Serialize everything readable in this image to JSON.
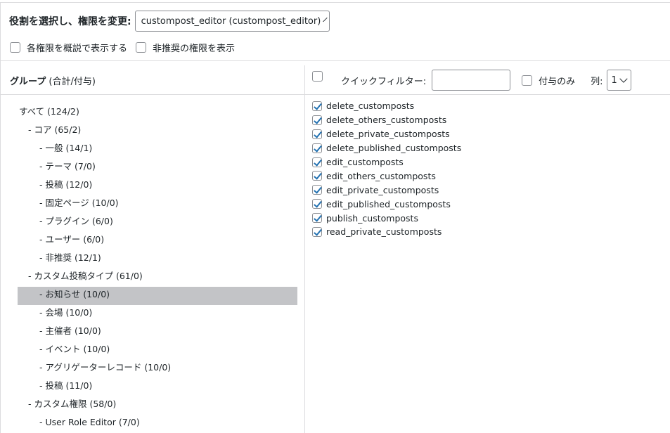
{
  "role": {
    "label": "役割を選択し、権限を変更:",
    "selected": "custompost_editor (custompost_editor)"
  },
  "options": {
    "show_readable": "各権限を概説で表示する",
    "show_deprecated": "非推奨の権限を表示"
  },
  "group_header": {
    "title": "グループ",
    "subtitle": "(合計/付与)"
  },
  "filter": {
    "quick_filter_label": "クイックフィルター:",
    "quick_filter_value": "",
    "granted_only_label": "付与のみ",
    "columns_label": "列:",
    "columns_value": "1"
  },
  "groups": [
    {
      "label": "すべて (124/2)",
      "level": 0,
      "selected": false
    },
    {
      "label": "- コア (65/2)",
      "level": 1,
      "selected": false
    },
    {
      "label": "- 一般 (14/1)",
      "level": 2,
      "selected": false
    },
    {
      "label": "- テーマ (7/0)",
      "level": 2,
      "selected": false
    },
    {
      "label": "- 投稿 (12/0)",
      "level": 2,
      "selected": false
    },
    {
      "label": "- 固定ページ (10/0)",
      "level": 2,
      "selected": false
    },
    {
      "label": "- プラグイン (6/0)",
      "level": 2,
      "selected": false
    },
    {
      "label": "- ユーザー (6/0)",
      "level": 2,
      "selected": false
    },
    {
      "label": "- 非推奨 (12/1)",
      "level": 2,
      "selected": false
    },
    {
      "label": "- カスタム投稿タイプ (61/0)",
      "level": 1,
      "selected": false
    },
    {
      "label": "- お知らせ (10/0)",
      "level": 2,
      "selected": true
    },
    {
      "label": "- 会場 (10/0)",
      "level": 2,
      "selected": false
    },
    {
      "label": "- 主催者 (10/0)",
      "level": 2,
      "selected": false
    },
    {
      "label": "- イベント (10/0)",
      "level": 2,
      "selected": false
    },
    {
      "label": "- アグリゲーターレコード (10/0)",
      "level": 2,
      "selected": false
    },
    {
      "label": "- 投稿 (11/0)",
      "level": 2,
      "selected": false
    },
    {
      "label": "- カスタム権限 (58/0)",
      "level": 1,
      "selected": false
    },
    {
      "label": "- User Role Editor (7/0)",
      "level": 2,
      "selected": false
    }
  ],
  "capabilities": [
    {
      "name": "delete_customposts",
      "checked": true
    },
    {
      "name": "delete_others_customposts",
      "checked": true
    },
    {
      "name": "delete_private_customposts",
      "checked": true
    },
    {
      "name": "delete_published_customposts",
      "checked": true
    },
    {
      "name": "edit_customposts",
      "checked": true
    },
    {
      "name": "edit_others_customposts",
      "checked": true
    },
    {
      "name": "edit_private_customposts",
      "checked": true
    },
    {
      "name": "edit_published_customposts",
      "checked": true
    },
    {
      "name": "publish_customposts",
      "checked": true
    },
    {
      "name": "read_private_customposts",
      "checked": true
    }
  ]
}
